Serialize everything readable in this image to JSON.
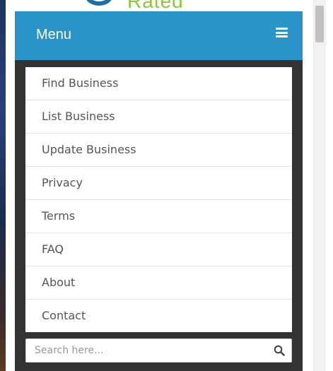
{
  "logo": {
    "text": "Rated"
  },
  "menu": {
    "title": "Menu",
    "items": [
      {
        "label": "Find Business"
      },
      {
        "label": "List Business"
      },
      {
        "label": "Update Business"
      },
      {
        "label": "Privacy"
      },
      {
        "label": "Terms"
      },
      {
        "label": "FAQ"
      },
      {
        "label": "About"
      },
      {
        "label": "Contact"
      }
    ]
  },
  "search": {
    "placeholder": "Search here...",
    "value": ""
  },
  "icons": {
    "menu": "hamburger-icon",
    "search": "search-icon"
  },
  "colors": {
    "header": "#2a93c7",
    "panel": "#333333",
    "logo_green": "#8cc63f",
    "logo_blue": "#1f6fa7"
  }
}
